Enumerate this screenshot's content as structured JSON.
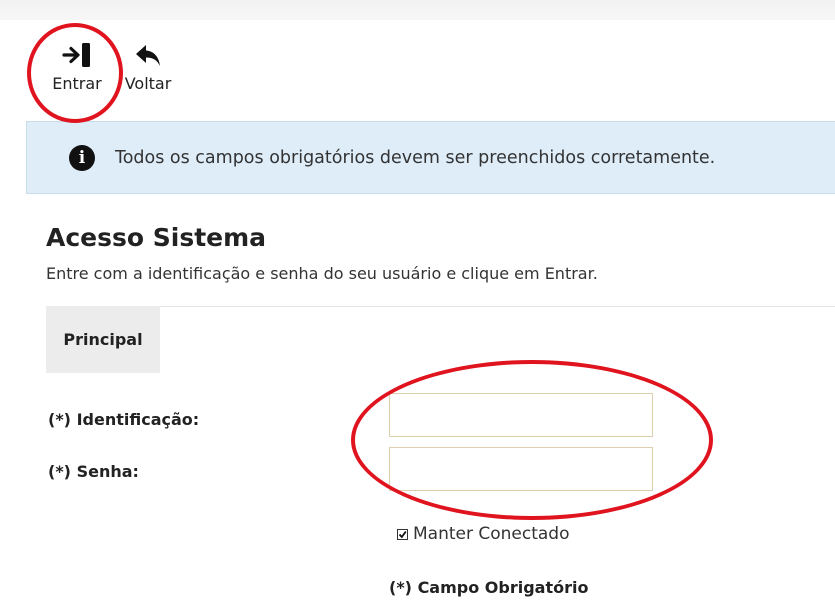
{
  "toolbar": {
    "entrar": {
      "label": "Entrar",
      "icon": "sign-in-icon"
    },
    "voltar": {
      "label": "Voltar",
      "icon": "undo-arrow-icon"
    }
  },
  "info": {
    "icon": "info-icon",
    "text": "Todos os campos obrigatórios devem ser preenchidos corretamente."
  },
  "page": {
    "title": "Acesso Sistema",
    "subtitle": "Entre com a identificação e senha do seu usuário e clique em Entrar."
  },
  "tabs": [
    {
      "label": "Principal",
      "active": true
    }
  ],
  "form": {
    "identificacao": {
      "label": "(*) Identificação:",
      "value": ""
    },
    "senha": {
      "label": "(*) Senha:",
      "value": ""
    },
    "manter_conectado": {
      "label": "Manter Conectado",
      "checked": true
    },
    "required_note": "(*) Campo Obrigatório"
  },
  "colors": {
    "annotation_red": "#e0141e",
    "info_background": "#deedf8",
    "tab_background": "#ececec",
    "input_border": "#dccfae"
  }
}
